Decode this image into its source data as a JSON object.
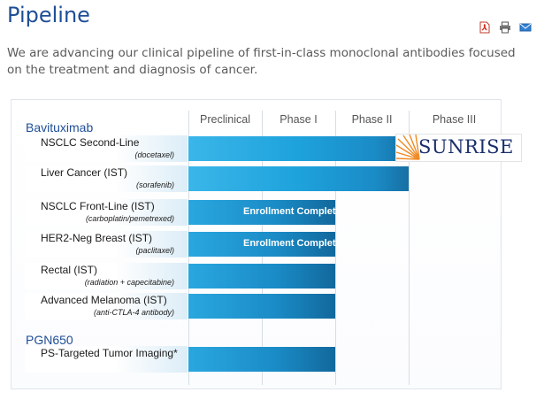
{
  "header": {
    "title": "Pipeline"
  },
  "toolbar": {
    "icons": [
      "pdf-icon",
      "print-icon",
      "email-icon"
    ]
  },
  "intro": {
    "text": "We are advancing our clinical pipeline of first-in-class monoclonal antibodies focused on the treatment and diagnosis of cancer."
  },
  "phases": [
    "Preclinical",
    "Phase I",
    "Phase II",
    "Phase III"
  ],
  "groups": [
    {
      "title": "Bavituximab"
    },
    {
      "title": "PGN650"
    }
  ],
  "rows": [
    {
      "name": "NSCLC Second-Line",
      "sub": "(docetaxel)",
      "progress_phases": 3.0,
      "bar_text": "",
      "partner": "SUNRISE"
    },
    {
      "name": "Liver Cancer (IST)",
      "sub": "(sorafenib)",
      "progress_phases": 3.0,
      "bar_text": ""
    },
    {
      "name": "NSCLC Front-Line (IST)",
      "sub": "(carboplatin/pemetrexed)",
      "progress_phases": 2.0,
      "bar_text": "Enrollment Complete"
    },
    {
      "name": "HER2-Neg Breast (IST)",
      "sub": "(paclitaxel)",
      "progress_phases": 2.0,
      "bar_text": "Enrollment Complete"
    },
    {
      "name": "Rectal (IST)",
      "sub": "(radiation + capecitabine)",
      "progress_phases": 2.0,
      "bar_text": ""
    },
    {
      "name": "Advanced Melanoma (IST)",
      "sub": "(anti-CTLA-4 antibody)",
      "progress_phases": 2.0,
      "bar_text": ""
    },
    {
      "name": "PS-Targeted Tumor Imaging*",
      "sub": "",
      "progress_phases": 2.0,
      "bar_text": ""
    }
  ],
  "colors": {
    "title": "#1f4e96",
    "bar_light": "#3ab6e9",
    "bar_dark": "#176fa3",
    "partner_text": "#1a2f6b",
    "sun": "#f08a24"
  }
}
